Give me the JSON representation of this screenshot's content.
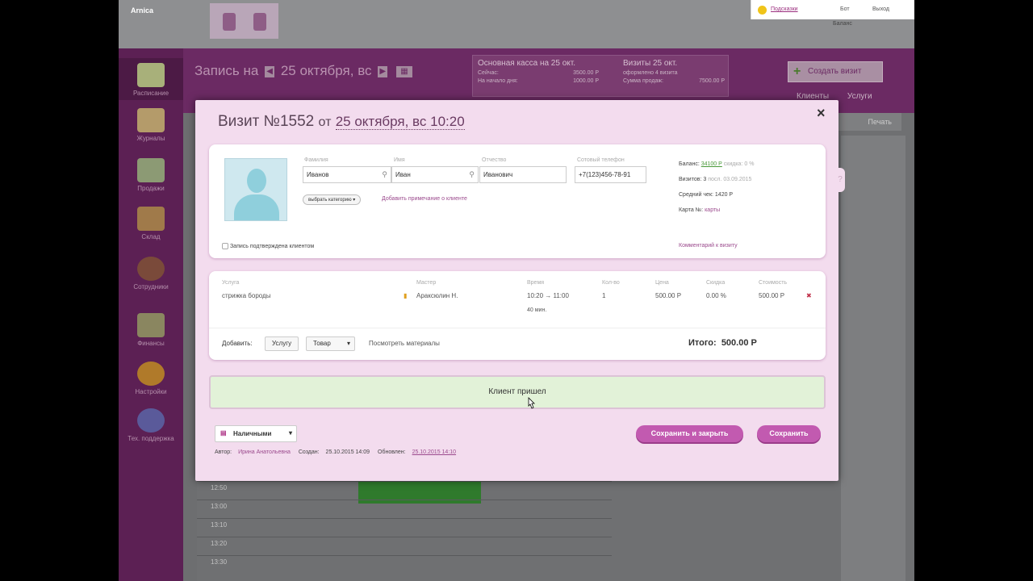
{
  "app": {
    "brand": "Arnica"
  },
  "hints": {
    "link": "Подсказки",
    "mid": "Бот",
    "right": "Выход"
  },
  "user": {
    "balance": "Баланс"
  },
  "header": {
    "title_prefix": "Запись на",
    "date": "25 октября, вс",
    "cash_title": "Основная касса на 25 окт.",
    "cash_rows": [
      {
        "k": "Сейчас:",
        "v": "3500.00 Р"
      },
      {
        "k": "На начало дня:",
        "v": "1000.00 Р"
      }
    ],
    "visits_title": "Визиты 25 окт.",
    "visits_rows": [
      {
        "k": "оформлено 4 визита",
        "v": ""
      },
      {
        "k": "Сумма продаж:",
        "v": "7500.00 Р"
      }
    ],
    "create_visit": "Создать визит",
    "links": [
      "Клиенты",
      "Услуги"
    ],
    "print": "Печать"
  },
  "sidebar": {
    "items": [
      {
        "label": "Расписание",
        "active": true
      },
      {
        "label": "Журналы"
      },
      {
        "label": "Продажи"
      },
      {
        "label": "Склад"
      },
      {
        "label": "Сотрудники"
      },
      {
        "label": "Финансы"
      },
      {
        "label": "Настройки"
      },
      {
        "label": "Тех. поддержка"
      }
    ]
  },
  "calendar": {
    "times": [
      "12:50",
      "13:00",
      "13:10",
      "13:20",
      "13:30"
    ]
  },
  "modal": {
    "title": "Визит №1552",
    "from": "от",
    "datetime": "25 октября, вс 10:20",
    "close": "×",
    "client": {
      "surname_label": "Фамилия",
      "surname": "Иванов",
      "name_label": "Имя",
      "name": "Иван",
      "patronymic_label": "Отчество",
      "patronymic": "Иванович",
      "phone_label": "Сотовый телефон",
      "phone": "+7(123)456-78-91",
      "category": "выбрать категорию ▾",
      "note_link": "Добавить примечание о клиенте",
      "confirmed": "Запись подтверждена клиентом",
      "comment_link": "Комментарий к визиту",
      "balance_label": "Баланс:",
      "balance": "34100 Р",
      "discount_label": "скидка:",
      "discount": "0 %",
      "visits_label": "Визитов:",
      "visits": "3",
      "last_visit": "посл. 03.09.2015",
      "avg_label": "Средний чек:",
      "avg": "1420 Р",
      "card_label": "Карта №:",
      "card": "карты"
    },
    "services": {
      "headers": [
        "Услуга",
        "Мастер",
        "Время",
        "Кол-во",
        "Цена",
        "Скидка",
        "Стоимость"
      ],
      "row": {
        "service": "стрижка бороды",
        "master": "Араксюлин Н.",
        "time": "10:20 → 11:00",
        "duration": "40 мин.",
        "qty": "1",
        "price": "500.00 Р",
        "discount": "0.00 %",
        "cost": "500.00 Р"
      },
      "add_label": "Добавить:",
      "add_service": "Услугу",
      "add_goods": "Товар",
      "materials": "Посмотреть материалы",
      "total_label": "Итого:",
      "total": "500.00 Р"
    },
    "arrived": "Клиент пришел",
    "payment": "Наличными",
    "save_close": "Сохранить и закрыть",
    "save": "Сохранить",
    "footer": {
      "author_label": "Автор:",
      "author": "Ирина Анатольевна",
      "created_label": "Создан:",
      "created": "25.10.2015 14:09",
      "updated_label": "Обновлен:",
      "updated": "25.10.2015 14:10"
    }
  }
}
